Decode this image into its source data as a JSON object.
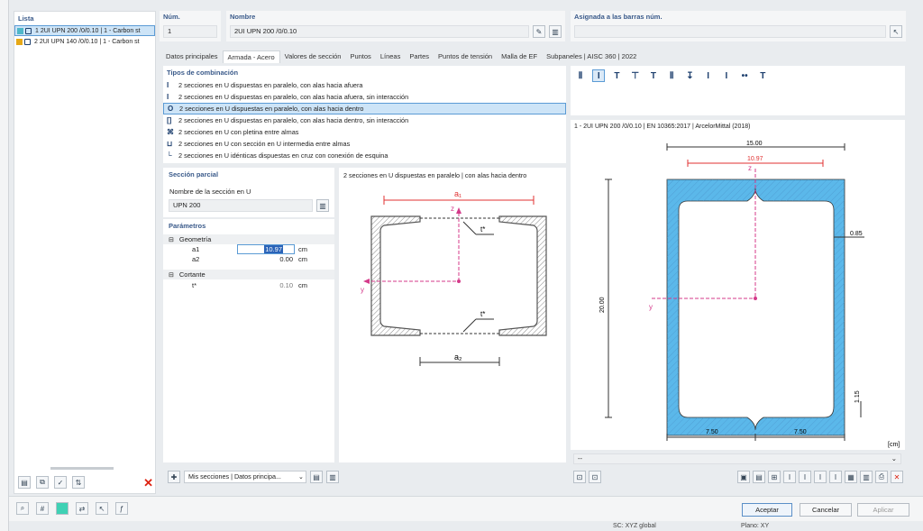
{
  "list": {
    "header": "Lista",
    "items": [
      {
        "text": "1  2UI UPN 200 /0/0.10 | 1 - Carbon st",
        "color": "#4fb7c9"
      },
      {
        "text": "2  2UI UPN 140 /0/0.10 | 1 - Carbon st",
        "color": "#e6a817"
      }
    ]
  },
  "num": {
    "label": "Núm.",
    "value": "1"
  },
  "nombre": {
    "label": "Nombre",
    "value": "2UI UPN 200 /0/0.10"
  },
  "asignada": {
    "label": "Asignada a las barras núm.",
    "value": ""
  },
  "tabs": [
    "Datos principales",
    "Armada - Acero",
    "Valores de sección",
    "Puntos",
    "Líneas",
    "Partes",
    "Puntos de tensión",
    "Malla de EF",
    "Subpaneles | AISC 360 | 2022"
  ],
  "tipos": {
    "header": "Tipos de combinación",
    "items": [
      {
        "icon": "I",
        "text": "2 secciones en U dispuestas en paralelo, con alas hacia afuera"
      },
      {
        "icon": "I",
        "text": "2 secciones en U dispuestas en paralelo, con alas hacia afuera, sin interacción"
      },
      {
        "icon": "O",
        "text": "2 secciones en U dispuestas en paralelo, con alas hacia dentro"
      },
      {
        "icon": "[]",
        "text": "2 secciones en U dispuestas en paralelo, con alas hacia dentro, sin interacción"
      },
      {
        "icon": "⌘",
        "text": "2 secciones en U con pletina entre almas"
      },
      {
        "icon": "⊔",
        "text": "2 secciones en U con sección en U intermedia entre almas"
      },
      {
        "icon": "└",
        "text": "2 secciones en U idénticas dispuestas en cruz con conexión de esquina"
      }
    ]
  },
  "seccion": {
    "header": "Sección parcial",
    "label": "Nombre de la sección en U",
    "value": "UPN 200"
  },
  "parametros": {
    "header": "Parámetros",
    "geometria": "Geometría",
    "a1_label": "a1",
    "a1_value": "10.97",
    "a1_unit": "cm",
    "a2_label": "a2",
    "a2_value": "0.00",
    "a2_unit": "cm",
    "cortante": "Cortante",
    "t_label": "t*",
    "t_value": "0.10",
    "t_unit": "cm"
  },
  "sketch": {
    "title": "2 secciones en U dispuestas en paralelo | con alas hacia dentro",
    "a1": "a1",
    "a2": "a2",
    "z": "z",
    "y": "y",
    "t1": "t*",
    "t2": "t*"
  },
  "drawing": {
    "title": "1 - 2UI UPN 200 /0/0.10 | EN 10365:2017 | ArcelorMittal (2018)",
    "dim_top": "15.00",
    "dim_a1": "10.97",
    "dim_height": "20.00",
    "dim_web": "0.85",
    "dim_flange": "1.15",
    "dim_left": "7.50",
    "dim_right": "7.50",
    "unit": "[cm]",
    "z": "z",
    "y": "y",
    "status": "--"
  },
  "bottom": {
    "mis_secciones": "Mis secciones | Datos principa...",
    "aceptar": "Aceptar",
    "cancelar": "Cancelar",
    "aplicar": "Aplicar",
    "sc": "SC: XYZ global",
    "plano": "Plano: XY"
  }
}
